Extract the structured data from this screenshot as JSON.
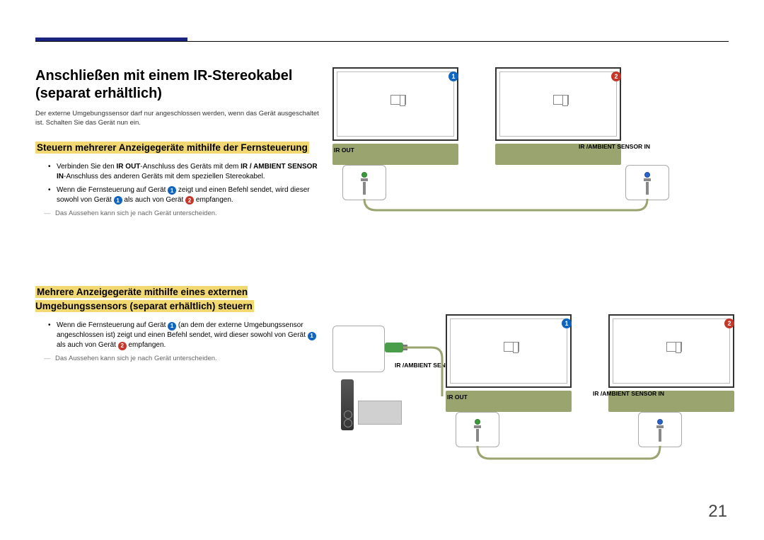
{
  "title": "Anschließen mit einem IR-Stereokabel (separat erhältlich)",
  "intro": "Der externe Umgebungssensor darf nur angeschlossen werden, wenn das Gerät ausgeschaltet ist. Schalten Sie das Gerät nun ein.",
  "section1": {
    "heading": "Steuern mehrerer Anzeigegeräte mithilfe der Fernsteuerung",
    "bullet1_a": "Verbinden Sie den ",
    "bullet1_b": "IR OUT",
    "bullet1_c": "-Anschluss des Geräts mit dem ",
    "bullet1_d": "IR / AMBIENT SENSOR IN",
    "bullet1_e": "-Anschluss des anderen Geräts mit dem speziellen Stereokabel.",
    "bullet2_a": "Wenn die Fernsteuerung auf Gerät ",
    "bullet2_b": " zeigt und einen Befehl sendet, wird dieser sowohl von Gerät ",
    "bullet2_c": " als auch von Gerät ",
    "bullet2_d": " empfangen.",
    "note": "Das Aussehen kann sich je nach Gerät unterscheiden."
  },
  "section2": {
    "heading": "Mehrere Anzeigegeräte mithilfe eines externen Umgebungssensors (separat erhältlich) steuern",
    "bullet1_a": "Wenn die Fernsteuerung auf Gerät ",
    "bullet1_b": " (an dem der externe Umgebungssensor angeschlossen ist) zeigt und einen Befehl sendet, wird dieser sowohl von Gerät ",
    "bullet1_c": " als auch von Gerät ",
    "bullet1_d": " empfangen.",
    "note": "Das Aussehen kann sich je nach Gerät unterscheiden."
  },
  "labels": {
    "ir_out": "IR OUT",
    "ir_ambient": "IR /AMBIENT SENSOR IN"
  },
  "badges": {
    "one": "1",
    "two": "2"
  },
  "page_number": "21"
}
